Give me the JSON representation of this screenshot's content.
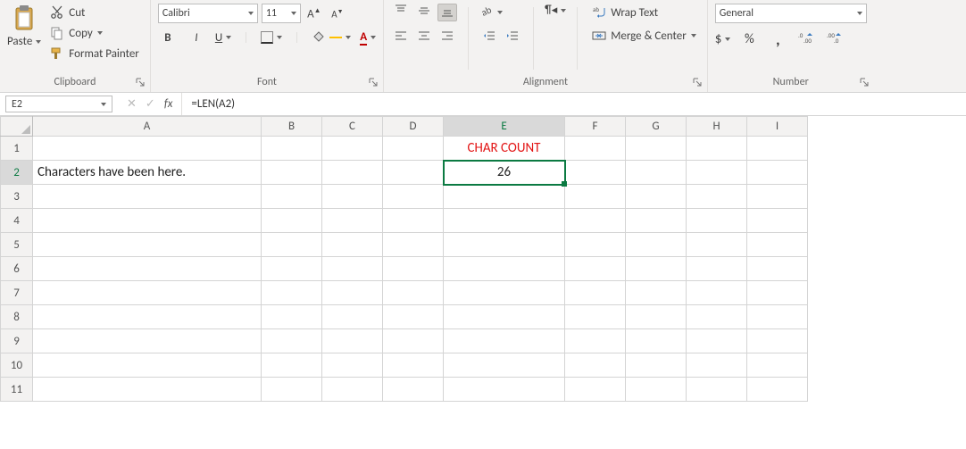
{
  "ribbon": {
    "clipboard": {
      "paste_label": "Paste",
      "cut_label": "Cut",
      "copy_label": "Copy",
      "format_painter_label": "Format Painter",
      "group_label": "Clipboard"
    },
    "font": {
      "font_name": "Calibri",
      "font_size": "11",
      "bold": "B",
      "italic": "I",
      "underline": "U",
      "group_label": "Font"
    },
    "alignment": {
      "wrap_text_label": "Wrap Text",
      "merge_center_label": "Merge & Center",
      "group_label": "Alignment"
    },
    "number": {
      "format_name": "General",
      "currency": "$",
      "percent": "%",
      "comma": ",",
      "inc_dec": ".0",
      "group_label": "Number"
    }
  },
  "formula_bar": {
    "name_box": "E2",
    "fx": "fx",
    "formula": "=LEN(A2)"
  },
  "grid": {
    "columns": [
      "A",
      "B",
      "C",
      "D",
      "E",
      "F",
      "G",
      "H",
      "I"
    ],
    "rows": [
      "1",
      "2",
      "3",
      "4",
      "5",
      "6",
      "7",
      "8",
      "9",
      "10",
      "11"
    ],
    "cells": {
      "E1": "CHAR COUNT",
      "A2": "Characters have been here.",
      "E2": "26"
    },
    "selected_cell": "E2"
  },
  "chart_data": null
}
